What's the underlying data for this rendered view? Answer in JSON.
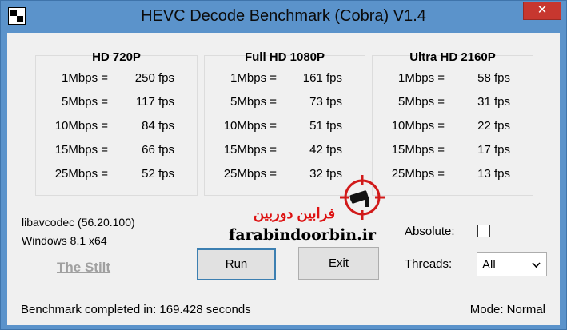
{
  "window": {
    "title": "HEVC Decode Benchmark (Cobra) V1.4",
    "close_glyph": "✕"
  },
  "groups": [
    {
      "title": "HD 720P",
      "rows": [
        {
          "rate": "1Mbps =",
          "fps": "250 fps"
        },
        {
          "rate": "5Mbps =",
          "fps": "117 fps"
        },
        {
          "rate": "10Mbps =",
          "fps": "84 fps"
        },
        {
          "rate": "15Mbps =",
          "fps": "66 fps"
        },
        {
          "rate": "25Mbps =",
          "fps": "52 fps"
        }
      ]
    },
    {
      "title": "Full HD 1080P",
      "rows": [
        {
          "rate": "1Mbps =",
          "fps": "161 fps"
        },
        {
          "rate": "5Mbps =",
          "fps": "73 fps"
        },
        {
          "rate": "10Mbps =",
          "fps": "51 fps"
        },
        {
          "rate": "15Mbps =",
          "fps": "42 fps"
        },
        {
          "rate": "25Mbps =",
          "fps": "32 fps"
        }
      ]
    },
    {
      "title": "Ultra HD 2160P",
      "rows": [
        {
          "rate": "1Mbps =",
          "fps": "58 fps"
        },
        {
          "rate": "5Mbps =",
          "fps": "31 fps"
        },
        {
          "rate": "10Mbps =",
          "fps": "22 fps"
        },
        {
          "rate": "15Mbps =",
          "fps": "17 fps"
        },
        {
          "rate": "25Mbps =",
          "fps": "13 fps"
        }
      ]
    }
  ],
  "info": {
    "libavcodec": "libavcodec (56.20.100)",
    "os": "Windows 8.1 x64",
    "author_link": "The Stilt"
  },
  "buttons": {
    "run": "Run",
    "exit": "Exit"
  },
  "options": {
    "absolute_label": "Absolute:",
    "absolute_checked": false,
    "threads_label": "Threads:",
    "threads_value": "All"
  },
  "status": {
    "left": "Benchmark completed in: 169.428 seconds",
    "right": "Mode: Normal"
  },
  "watermark": {
    "text_fa": "فرابین دوربین",
    "text_en": "farabindoorbin.ir",
    "brand_color": "#d11a1a"
  }
}
